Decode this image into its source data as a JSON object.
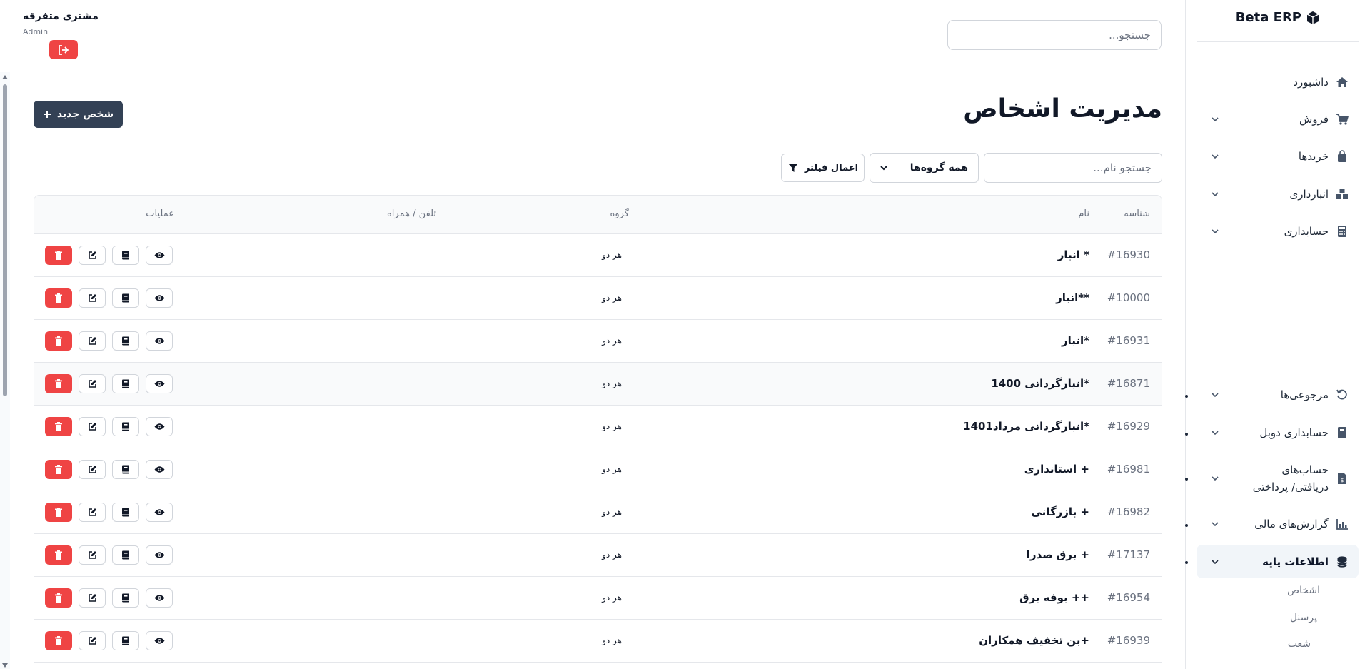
{
  "sidebar": {
    "brand": "Beta ERP",
    "nav": [
      {
        "label": "داشبورد",
        "icon": "home-icon"
      },
      {
        "label": "فروش",
        "icon": "cart-icon"
      },
      {
        "label": "خریدها",
        "icon": "bag-icon"
      },
      {
        "label": "انبارداری",
        "icon": "boxes-icon"
      },
      {
        "label": "حسابداری",
        "icon": "calculator-icon"
      },
      {
        "label": "مرجوعی‌ها",
        "icon": "undo-icon"
      },
      {
        "label": "حسابداری دوبل",
        "icon": "book-icon"
      },
      {
        "label": "حساب‌های دریافتی/ پرداختی",
        "icon": "invoice-icon"
      },
      {
        "label": "گزارش‌های مالی",
        "icon": "chart-icon"
      },
      {
        "label": "اطلاعات پایه",
        "icon": "database-icon"
      }
    ],
    "sub_items": [
      "اشخاص",
      "پرسنل",
      "شعب"
    ]
  },
  "header": {
    "search_placeholder": "جستجو...",
    "user_name": "مشتری متفرقه",
    "user_role": "Admin"
  },
  "main": {
    "title": "مدیریت اشخاص",
    "new_button": "شخص جدید",
    "filter_search_placeholder": "جستجو نام...",
    "group_select_value": "همه گروه‌ها",
    "apply_filter_label": "اعمال فیلتر"
  },
  "table": {
    "headers": {
      "id": "شناسه",
      "name": "نام",
      "group": "گروه",
      "phone": "تلفن / همراه",
      "actions": "عملیات"
    },
    "rows": [
      {
        "id": "#16930",
        "name": "* انبار",
        "group": "هر دو"
      },
      {
        "id": "#10000",
        "name": "**انبار",
        "group": "هر دو"
      },
      {
        "id": "#16931",
        "name": "*انبار",
        "group": "هر دو"
      },
      {
        "id": "#16871",
        "name": "*انبارگردانی 1400",
        "group": "هر دو"
      },
      {
        "id": "#16929",
        "name": "*انبارگردانی مرداد1401",
        "group": "هر دو"
      },
      {
        "id": "#16981",
        "name": "+ استانداری",
        "group": "هر دو"
      },
      {
        "id": "#16982",
        "name": "+ بازرگانی",
        "group": "هر دو"
      },
      {
        "id": "#17137",
        "name": "+ برق صدرا",
        "group": "هر دو"
      },
      {
        "id": "#16954",
        "name": "++ بوفه برق",
        "group": "هر دو"
      },
      {
        "id": "#16939",
        "name": "+بن تخفیف همکاران",
        "group": "هر دو"
      }
    ]
  },
  "colors": {
    "primary_dark": "#334155",
    "danger": "#ef4444",
    "border": "#e5e7eb",
    "muted_text": "#6b7280"
  }
}
